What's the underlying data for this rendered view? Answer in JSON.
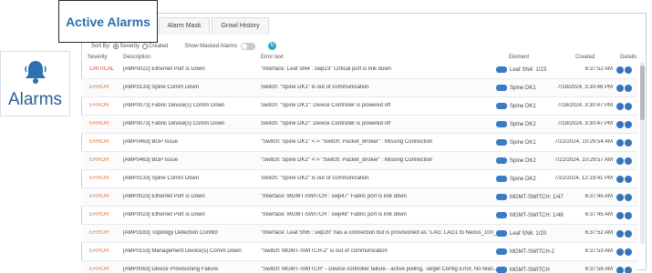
{
  "sidebar": {
    "label": "Alarms",
    "icon": "bell-icon"
  },
  "tabs": {
    "active": "Active Alarms",
    "mask": "Alarm Mask",
    "growl": "Growl History"
  },
  "controls": {
    "sort_by": "Sort By:",
    "sort_severity": "Severity",
    "sort_created": "Created",
    "show_masked": "Show Masked Alarms"
  },
  "columns": {
    "severity": "Severity",
    "description": "Description",
    "error": "Error text",
    "element": "Element",
    "created": "Created",
    "details": "Details"
  },
  "rows": [
    {
      "severity": "CRITICAL",
      "description": "[AMP0022] Ethernet Port is Down",
      "error": "\"Interface: Leaf SN4 : swp23\" Critical port is link down",
      "element": "Leaf SN4: 1/23",
      "created": "6:37:52 AM"
    },
    {
      "severity": "ERROR",
      "description": "[AMP0133] Spine Comm Down",
      "error": "Switch: \"Spine DK1\" is out of communication",
      "element": "Spine DK1",
      "created": "7/18/2024, 3:30:46 PM"
    },
    {
      "severity": "ERROR",
      "description": "[AMP0073] Fabric Device(s) Comm Down",
      "error": "Switch: \"Spine DK1\": Device Controller is powered off",
      "element": "Spine DK1",
      "created": "7/18/2024, 3:30:47 PM"
    },
    {
      "severity": "ERROR",
      "description": "[AMP0073] Fabric Device(s) Comm Down",
      "error": "Switch: \"Spine DK2\": Device Controller is powered off",
      "element": "Spine DK2",
      "created": "7/18/2024, 3:30:47 PM"
    },
    {
      "severity": "ERROR",
      "description": "[AMP0463] BGP Issue",
      "error": "\"Switch: Spine DK1\" <-> \"Switch: Packet_Broker\" : Missing Connection",
      "element": "Spine DK1",
      "created": "7/22/2024, 10:29:54 AM"
    },
    {
      "severity": "ERROR",
      "description": "[AMP0463] BGP Issue",
      "error": "\"Switch: Spine DK2\" <-> \"Switch: Packet_Broker\" : Missing Connection",
      "element": "Spine DK2",
      "created": "7/22/2024, 10:29:57 AM"
    },
    {
      "severity": "ERROR",
      "description": "[AMP0133] Spine Comm Down",
      "error": "Switch: \"Spine DK2\" is out of communication",
      "element": "Spine DK2",
      "created": "7/22/2024, 12:19:41 PM"
    },
    {
      "severity": "ERROR",
      "description": "[AMP0023] Ethernet Port is Down",
      "error": "\"Interface: MGMT-SWITCH : swp47\" Fabric port is link down",
      "element": "MGMT-SWITCH: 1/47",
      "created": "6:37:45 AM"
    },
    {
      "severity": "ERROR",
      "description": "[AMP0023] Ethernet Port is Down",
      "error": "\"Interface: MGMT-SWITCH : swp48\" Fabric port is link down",
      "element": "MGMT-SWITCH: 1/48",
      "created": "6:37:45 AM"
    },
    {
      "severity": "ERROR",
      "description": "[AMP0183] Topology Detection Conflict",
      "error": "\"Interface: Leaf SN6 : swp20\" has a connection but is provisioned as \"LAG: LAG1 to Nexus_100_...",
      "element": "Leaf SN6: 1/20",
      "created": "6:37:52 AM"
    },
    {
      "severity": "ERROR",
      "description": "[AMP0153] Management Device(s) Comm Down",
      "error": "\"Switch: MGMT-SWITCH-2\" is out of communication",
      "element": "MGMT-SWITCH-2",
      "created": "6:37:53 AM"
    },
    {
      "severity": "ERROR",
      "description": "[AMP0063] Device Provisioning Failure",
      "error": "\"Switch: MGMT-SWITCH\" - Device controller failure - active polling, Target Config Error, No Man...",
      "element": "MGMT-SWITCH",
      "created": "6:37:58 AM"
    }
  ],
  "colors": {
    "critical": "#d83a3a",
    "error": "#e87a3a",
    "accent": "#2e6fb0"
  }
}
